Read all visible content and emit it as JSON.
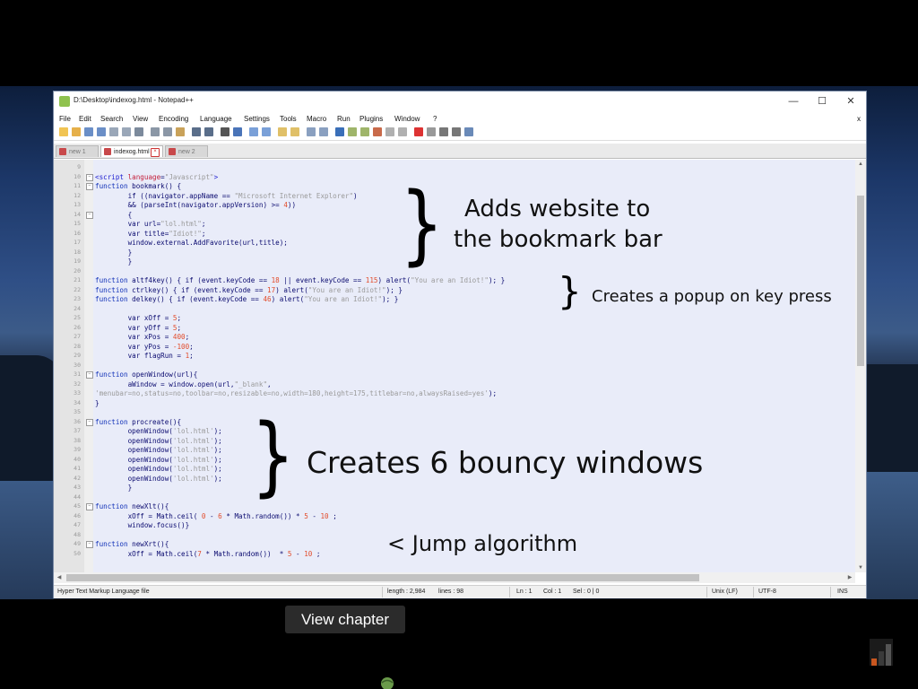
{
  "window": {
    "title": "D:\\Desktop\\indexog.html - Notepad++",
    "minimize": "—",
    "maximize": "☐",
    "close": "✕",
    "doc_close": "x"
  },
  "menu": [
    "File",
    "Edit",
    "Search",
    "View",
    "Encoding",
    "Language",
    "Settings",
    "Tools",
    "Macro",
    "Run",
    "Plugins",
    "Window",
    "?"
  ],
  "tabs": [
    {
      "label": "new 1",
      "active": false
    },
    {
      "label": "indexog.html",
      "active": true
    },
    {
      "label": "new 2",
      "active": false
    }
  ],
  "code": [
    {
      "n": "9",
      "text": ""
    },
    {
      "n": "10",
      "html": "<span class='tag'>&lt;script</span> <span class='attr'>language</span>=<span class='str'>\"Javascript\"</span><span class='tag'>&gt;</span>"
    },
    {
      "n": "11",
      "html": "<span class='kw'>function</span> bookmark() {"
    },
    {
      "n": "12",
      "html": "        if ((navigator.appName == <span class='str'>\"Microsoft Internet Explorer\"</span>)"
    },
    {
      "n": "13",
      "html": "        &amp;&amp; (parseInt(navigator.appVersion) &gt;= <span class='num'>4</span>))"
    },
    {
      "n": "14",
      "html": "        {"
    },
    {
      "n": "15",
      "html": "        var url=<span class='str'>\"lol.html\"</span>;"
    },
    {
      "n": "16",
      "html": "        var title=<span class='str'>\"Idiot!\"</span>;"
    },
    {
      "n": "17",
      "html": "        window.external.AddFavorite(url,title);"
    },
    {
      "n": "18",
      "html": "        }"
    },
    {
      "n": "19",
      "html": "        }"
    },
    {
      "n": "20",
      "html": ""
    },
    {
      "n": "21",
      "html": "<span class='kw'>function</span> altf4key() { if (event.keyCode == <span class='num'>18</span> || event.keyCode == <span class='num'>115</span>) alert(<span class='str'>\"You are an Idiot!\"</span>); }"
    },
    {
      "n": "22",
      "html": "<span class='kw'>function</span> ctrlkey() { if (event.keyCode == <span class='num'>17</span>) alert(<span class='str'>\"You are an Idiot!\"</span>); }"
    },
    {
      "n": "23",
      "html": "<span class='kw'>function</span> delkey() { if (event.keyCode == <span class='num'>46</span>) alert(<span class='str'>\"You are an Idiot!\"</span>); }"
    },
    {
      "n": "24",
      "html": ""
    },
    {
      "n": "25",
      "html": "        var xOff = <span class='num'>5</span>;"
    },
    {
      "n": "26",
      "html": "        var yOff = <span class='num'>5</span>;"
    },
    {
      "n": "27",
      "html": "        var xPos = <span class='num'>400</span>;"
    },
    {
      "n": "28",
      "html": "        var yPos = <span class='num'>-100</span>;"
    },
    {
      "n": "29",
      "html": "        var flagRun = <span class='num'>1</span>;"
    },
    {
      "n": "30",
      "html": ""
    },
    {
      "n": "31",
      "html": "<span class='kw'>function</span> openWindow(url){"
    },
    {
      "n": "32",
      "html": "        aWindow = window.open(url,<span class='str'>\"_blank\"</span>,"
    },
    {
      "n": "33",
      "html": "<span class='str'>'menubar=no,status=no,toolbar=no,resizable=no,width=180,height=175,titlebar=no,alwaysRaised=yes'</span>);"
    },
    {
      "n": "34",
      "html": "}"
    },
    {
      "n": "35",
      "html": ""
    },
    {
      "n": "36",
      "html": "<span class='kw'>function</span> procreate(){"
    },
    {
      "n": "37",
      "html": "        openWindow(<span class='str'>'lol.html'</span>);"
    },
    {
      "n": "38",
      "html": "        openWindow(<span class='str'>'lol.html'</span>);"
    },
    {
      "n": "39",
      "html": "        openWindow(<span class='str'>'lol.html'</span>);"
    },
    {
      "n": "40",
      "html": "        openWindow(<span class='str'>'lol.html'</span>);"
    },
    {
      "n": "41",
      "html": "        openWindow(<span class='str'>'lol.html'</span>);"
    },
    {
      "n": "42",
      "html": "        openWindow(<span class='str'>'lol.html'</span>);"
    },
    {
      "n": "43",
      "html": "        }"
    },
    {
      "n": "44",
      "html": ""
    },
    {
      "n": "45",
      "html": "<span class='kw'>function</span> newXlt(){"
    },
    {
      "n": "46",
      "html": "        xOff = Math.ceil( <span class='num'>0</span> - <span class='num'>6</span> * Math.random()) * <span class='num'>5</span> - <span class='num'>10</span> ;"
    },
    {
      "n": "47",
      "html": "        window.focus()}"
    },
    {
      "n": "48",
      "html": ""
    },
    {
      "n": "49",
      "html": "<span class='kw'>function</span> newXrt(){"
    },
    {
      "n": "50",
      "html": "        xOff = Math.ceil(<span class='num'>7</span> * Math.random())  * <span class='num'>5</span> - <span class='num'>10</span> ;"
    }
  ],
  "annotations": {
    "bookmark": [
      "Adds website to",
      "the bookmark bar"
    ],
    "popup": "Creates a popup on key press",
    "windows": "Creates 6 bouncy windows",
    "jump": "< Jump algorithm",
    "brace": "}"
  },
  "status": {
    "filetype": "Hyper Text Markup Language file",
    "length": "length : 2,984",
    "lines": "lines : 98",
    "ln": "Ln : 1",
    "col": "Col : 1",
    "sel": "Sel : 0 | 0",
    "eol": "Unix (LF)",
    "encoding": "UTF-8",
    "mode": "INS"
  },
  "overlay": {
    "view_chapter": "View chapter"
  }
}
